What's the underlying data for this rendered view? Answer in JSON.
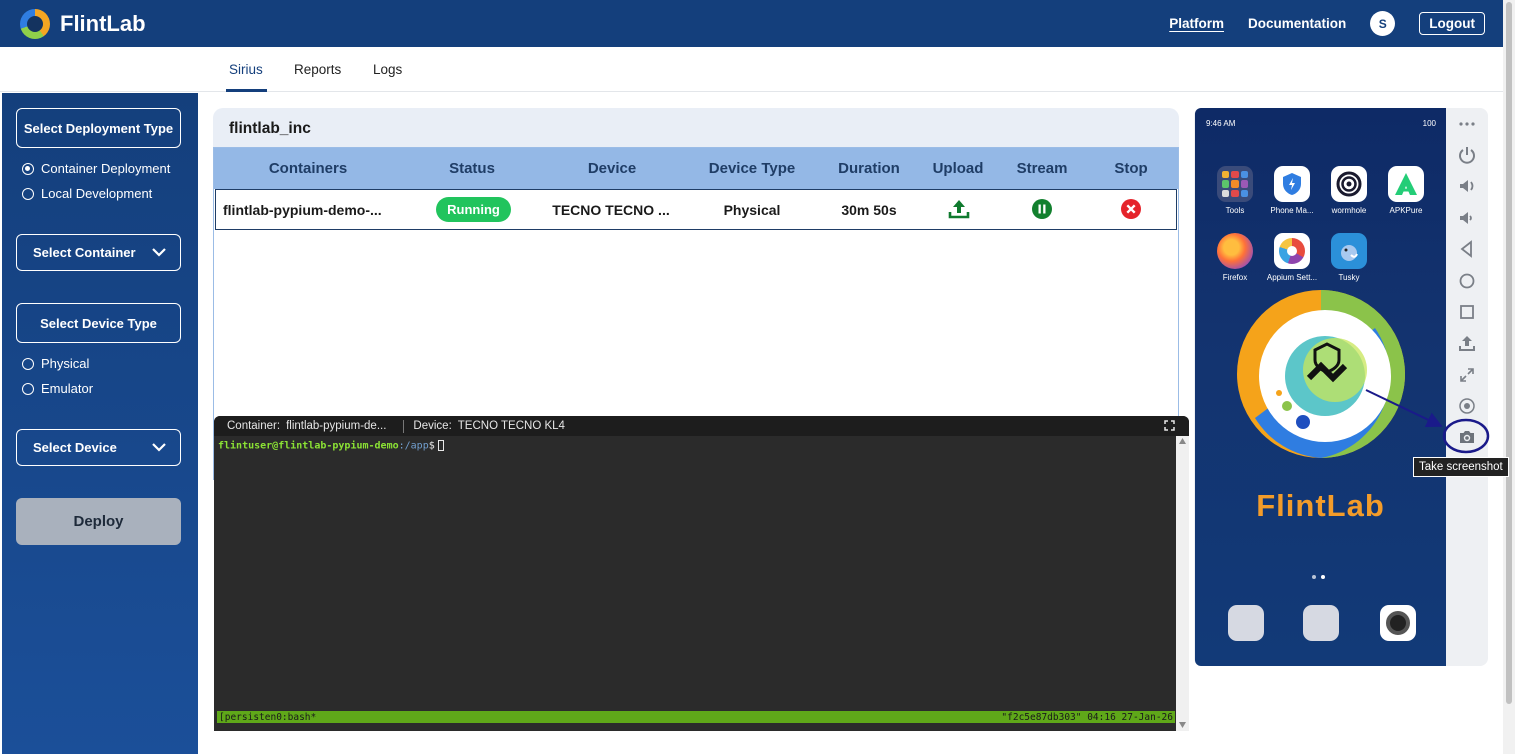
{
  "header": {
    "brand": "FlintLab",
    "nav": [
      "Platform",
      "Documentation"
    ],
    "avatar_initial": "S",
    "logout_label": "Logout"
  },
  "tabs": [
    "Sirius",
    "Reports",
    "Logs"
  ],
  "sidebar": {
    "deployment_type_label": "Select Deployment Type",
    "deployment_options": [
      {
        "label": "Container Deployment",
        "selected": true
      },
      {
        "label": "Local Development",
        "selected": false
      }
    ],
    "container_select_label": "Select Container",
    "device_type_label": "Select Device Type",
    "device_type_options": [
      {
        "label": "Physical",
        "selected": false
      },
      {
        "label": "Emulator",
        "selected": false
      }
    ],
    "device_select_label": "Select Device",
    "deploy_label": "Deploy"
  },
  "main": {
    "org_name": "flintlab_inc",
    "columns": [
      "Containers",
      "Status",
      "Device",
      "Device Type",
      "Duration",
      "Upload",
      "Stream",
      "Stop"
    ],
    "rows": [
      {
        "container": "flintlab-pypium-demo-...",
        "status": "Running",
        "device": "TECNO TECNO ...",
        "device_type": "Physical",
        "duration": "30m 50s"
      }
    ]
  },
  "terminal": {
    "container_label": "Container:",
    "container_value": "flintlab-pypium-de...",
    "device_label": "Device:",
    "device_value": "TECNO TECNO KL4",
    "prompt_user": "flintuser@flintlab-pypium-demo",
    "prompt_path": ":/app",
    "prompt_symbol": "$",
    "status_left": "[persisten0:bash*",
    "status_right": "\"f2c5e87db303\" 04:16 27-Jan-26"
  },
  "phone": {
    "status_time": "9:46 AM",
    "status_right": "100",
    "apps": [
      "Tools",
      "Phone Ma...",
      "wormhole",
      "APKPure",
      "Firefox",
      "Appium Sett...",
      "Tusky"
    ],
    "brand_text": "FlintLab"
  },
  "device_tools": {
    "tooltip": "Take screenshot"
  },
  "colors": {
    "primary": "#143f7c",
    "table_header": "#94b8e6",
    "running": "#21c45d",
    "stop": "#e5242b",
    "stream": "#12802e",
    "upload": "#0f7a2e",
    "terminal_status": "#5fa819"
  }
}
